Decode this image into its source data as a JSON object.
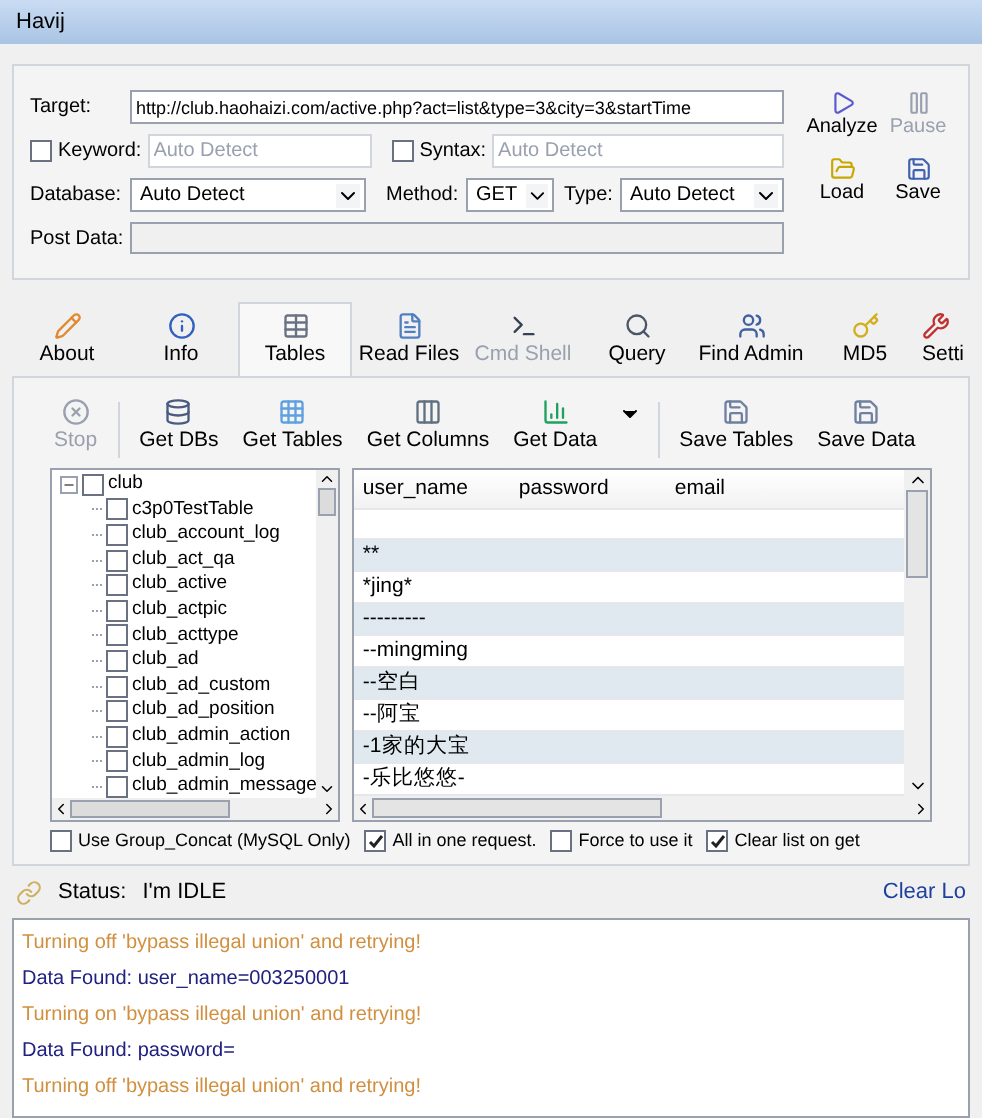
{
  "window": {
    "title": "Havij"
  },
  "form": {
    "target": {
      "label": "Target:",
      "value": "http://club.haohaizi.com/active.php?act=list&type=3&city=3&startTime"
    },
    "keyword": {
      "label": "Keyword:",
      "checked": false,
      "placeholder": "Auto Detect"
    },
    "syntax": {
      "label": "Syntax:",
      "checked": false,
      "placeholder": "Auto Detect"
    },
    "database": {
      "label": "Database:",
      "value": "Auto Detect"
    },
    "method": {
      "label": "Method:",
      "value": "GET"
    },
    "type": {
      "label": "Type:",
      "value": "Auto Detect"
    },
    "post_data": {
      "label": "Post Data:"
    },
    "actions": [
      {
        "kind": "analyze",
        "label": "Analyze",
        "disabled": false
      },
      {
        "kind": "pause",
        "label": "Pause",
        "disabled": true
      },
      {
        "kind": "load",
        "label": "Load",
        "disabled": false
      },
      {
        "kind": "save",
        "label": "Save",
        "disabled": false
      }
    ]
  },
  "tabs": [
    {
      "kind": "about",
      "label": "About",
      "selected": false,
      "disabled": false
    },
    {
      "kind": "info",
      "label": "Info",
      "selected": false,
      "disabled": false
    },
    {
      "kind": "tables",
      "label": "Tables",
      "selected": true,
      "disabled": false
    },
    {
      "kind": "files",
      "label": "Read Files",
      "selected": false,
      "disabled": false
    },
    {
      "kind": "shell",
      "label": "Cmd Shell",
      "selected": false,
      "disabled": true
    },
    {
      "kind": "query",
      "label": "Query",
      "selected": false,
      "disabled": false
    },
    {
      "kind": "admin",
      "label": "Find Admin",
      "selected": false,
      "disabled": false
    },
    {
      "kind": "md5",
      "label": "MD5",
      "selected": false,
      "disabled": false
    },
    {
      "kind": "settings",
      "label": "Setti",
      "selected": false,
      "disabled": false
    }
  ],
  "toolbar": [
    {
      "kind": "stop",
      "label": "Stop",
      "disabled": true
    },
    {
      "kind": "dbs",
      "label": "Get DBs",
      "disabled": false
    },
    {
      "kind": "tables",
      "label": "Get Tables",
      "disabled": false
    },
    {
      "kind": "columns",
      "label": "Get Columns",
      "disabled": false
    },
    {
      "kind": "data",
      "label": "Get Data",
      "disabled": false
    },
    {
      "kind": "save_tables",
      "label": "Save Tables",
      "disabled": false
    },
    {
      "kind": "save_data",
      "label": "Save Data",
      "disabled": false
    }
  ],
  "tree": {
    "label": "club",
    "expanded": true,
    "checked": false,
    "children": [
      {
        "label": "c3p0TestTable",
        "checked": false
      },
      {
        "label": "club_account_log",
        "checked": false
      },
      {
        "label": "club_act_qa",
        "checked": false
      },
      {
        "label": "club_active",
        "checked": false
      },
      {
        "label": "club_actpic",
        "checked": false
      },
      {
        "label": "club_acttype",
        "checked": false
      },
      {
        "label": "club_ad",
        "checked": false
      },
      {
        "label": "club_ad_custom",
        "checked": false
      },
      {
        "label": "club_ad_position",
        "checked": false
      },
      {
        "label": "club_admin_action",
        "checked": false
      },
      {
        "label": "club_admin_log",
        "checked": false
      },
      {
        "label": "club_admin_message",
        "checked": false
      }
    ]
  },
  "grid": {
    "columns": [
      "user_name",
      "password",
      "email"
    ],
    "rows": [
      "**",
      "*jing*",
      "---------",
      "--mingming",
      "--空白",
      "--阿宝",
      "-1家的大宝",
      "-乐比悠悠-"
    ]
  },
  "options": [
    {
      "label": "Use Group_Concat (MySQL Only)",
      "checked": false
    },
    {
      "label": "All in one request.",
      "checked": true
    },
    {
      "label": "Force to use it",
      "checked": false
    },
    {
      "label": "Clear list on get",
      "checked": true
    }
  ],
  "status": {
    "label": "Status:",
    "value": "I'm IDLE",
    "clear_log": "Clear Lo"
  },
  "log": [
    {
      "kind": "warning",
      "text": "Turning off 'bypass illegal union' and retrying!"
    },
    {
      "kind": "found",
      "text": "Data Found: user_name=003250001"
    },
    {
      "kind": "warning",
      "text": "Turning on 'bypass illegal union' and retrying!"
    },
    {
      "kind": "found",
      "text": "Data Found: password="
    },
    {
      "kind": "warning",
      "text": "Turning off 'bypass illegal union' and retrying!"
    }
  ]
}
